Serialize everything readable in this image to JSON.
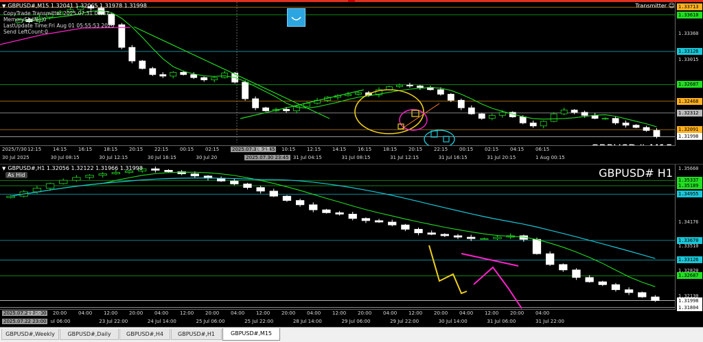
{
  "m15": {
    "symbol_line": "GBPUSD#,M15  1.32041 1.32065 1.31978 1.31998",
    "info_lines": [
      "CopyTrade Transmitter 2025.07.31 09:37",
      "MemorySlotNo:0",
      "LastUpdate Time:Fri Aug 01 05:55:53 2025",
      "Send LeftCount:0"
    ],
    "watermark": "GBPUSD# M15",
    "transmitter_label": "Transmitter",
    "smiley": "☺",
    "price_labels": [
      {
        "text": "1.33713",
        "bg": "#ffb020",
        "y": 1.33713
      },
      {
        "text": "1.33610",
        "bg": "#22dd22",
        "y": 1.3361
      },
      {
        "text": "1.33126",
        "bg": "#19c7d8",
        "y": 1.33126
      },
      {
        "text": "1.32687",
        "bg": "#22dd22",
        "y": 1.32687
      },
      {
        "text": "1.32468",
        "bg": "#ffb020",
        "y": 1.32468
      },
      {
        "text": "1.32312",
        "bg": "#bbbbbb",
        "y": 1.32312
      },
      {
        "text": "1.32091",
        "bg": "#ffb020",
        "y": 1.32091
      },
      {
        "text": "1.31998",
        "bg": "#ffffff",
        "y": 1.31998
      }
    ],
    "price_plain": [
      {
        "text": "1.33360",
        "y": 1.3336
      },
      {
        "text": "1.33015",
        "y": 1.33015
      }
    ],
    "time_labels": [
      {
        "text": "2025/7/30",
        "hl": false
      },
      {
        "text": "12:15",
        "hl": false
      },
      {
        "text": "14:15",
        "hl": false
      },
      {
        "text": "16:15",
        "hl": false
      },
      {
        "text": "18:15",
        "hl": false
      },
      {
        "text": "20:15",
        "hl": false
      },
      {
        "text": "22:15",
        "hl": false
      },
      {
        "text": "00:15",
        "hl": false
      },
      {
        "text": "02:15",
        "hl": false
      },
      {
        "text": "2025.07.31 05:45",
        "hl": true
      },
      {
        "text": "08:15",
        "hl": false
      },
      {
        "text": "10:15",
        "hl": false
      },
      {
        "text": "12:15",
        "hl": false
      },
      {
        "text": "14:15",
        "hl": false
      },
      {
        "text": "16:15",
        "hl": false
      },
      {
        "text": "18:15",
        "hl": false
      },
      {
        "text": "20:15",
        "hl": false
      },
      {
        "text": "22:15",
        "hl": false
      },
      {
        "text": "00:15",
        "hl": false
      },
      {
        "text": "02:15",
        "hl": false
      },
      {
        "text": "04:15",
        "hl": false
      },
      {
        "text": "06:15",
        "hl": false
      }
    ],
    "date_labels": [
      {
        "text": "30 Jul 2025",
        "hl": false
      },
      {
        "text": "30 Jul 08:15",
        "hl": false
      },
      {
        "text": "30 Jul 12:15",
        "hl": false
      },
      {
        "text": "30 Jul 16:15",
        "hl": false
      },
      {
        "text": "30 Jul 20",
        "hl": false
      },
      {
        "text": "2025.07.30 23:45",
        "hl": true
      },
      {
        "text": "31 Jul 04:15",
        "hl": false
      },
      {
        "text": "31 Jul 08:15",
        "hl": false
      },
      {
        "text": "31 Jul 12:15",
        "hl": false
      },
      {
        "text": "31 Jul 16:15",
        "hl": false
      },
      {
        "text": "31 Jul 20:15",
        "hl": false
      },
      {
        "text": "1 Aug 00:15",
        "hl": false
      }
    ]
  },
  "h1": {
    "symbol_line": "GBPUSD#,H1  1.32056 1.32122 1.31966 1.31998",
    "as_hide_label": "As Hid",
    "watermark": "GBPUSD# H1",
    "price_labels": [
      {
        "text": "1.35337",
        "bg": "#22dd22",
        "y": 1.35337
      },
      {
        "text": "1.35189",
        "bg": "#22dd22",
        "y": 1.35189
      },
      {
        "text": "1.34955",
        "bg": "#19c7d8",
        "y": 1.34955
      },
      {
        "text": "1.33670",
        "bg": "#19c7d8",
        "y": 1.3367
      },
      {
        "text": "1.33126",
        "bg": "#19c7d8",
        "y": 1.33126
      },
      {
        "text": "1.32687",
        "bg": "#22dd22",
        "y": 1.32687
      },
      {
        "text": "1.31998",
        "bg": "#ffffff",
        "y": 1.31998
      },
      {
        "text": "1.31804",
        "bg": "#ffffff",
        "y": 1.31804
      }
    ],
    "price_plain": [
      {
        "text": "1.35660",
        "y": 1.3566
      },
      {
        "text": "1.34176",
        "y": 1.34176
      },
      {
        "text": "1.33510",
        "y": 1.3351
      },
      {
        "text": "1.32820",
        "y": 1.3282
      },
      {
        "text": "1.32130",
        "y": 1.3213
      }
    ],
    "time_labels": [
      {
        "text": "2025.07.23 05:00",
        "hl": true
      },
      {
        "text": "22:00",
        "hl": false
      },
      {
        "text": "20:00",
        "hl": false
      },
      {
        "text": "04:00",
        "hl": false
      },
      {
        "text": "12:00",
        "hl": false
      },
      {
        "text": "20:00",
        "hl": false
      },
      {
        "text": "04:00",
        "hl": false
      },
      {
        "text": "12:00",
        "hl": false
      },
      {
        "text": "20:00",
        "hl": false
      },
      {
        "text": "04:00",
        "hl": false
      },
      {
        "text": "12:00",
        "hl": false
      },
      {
        "text": "20:00",
        "hl": false
      },
      {
        "text": "04:00",
        "hl": false
      },
      {
        "text": "12:00",
        "hl": false
      },
      {
        "text": "20:00",
        "hl": false
      },
      {
        "text": "04:00",
        "hl": false
      },
      {
        "text": "12:00",
        "hl": false
      },
      {
        "text": "20:00",
        "hl": false
      },
      {
        "text": "04:00",
        "hl": false
      },
      {
        "text": "12:00",
        "hl": false
      },
      {
        "text": "20:00",
        "hl": false
      },
      {
        "text": "04:00",
        "hl": false
      }
    ],
    "date_labels": [
      {
        "text": "2025.07.22 23:00",
        "hl": true
      },
      {
        "text": "ul 06:00",
        "hl": false
      },
      {
        "text": "23 Jul 22:00",
        "hl": false
      },
      {
        "text": "24 Jul 14:00",
        "hl": false
      },
      {
        "text": "25 Jul 06:00",
        "hl": false
      },
      {
        "text": "25 Jul 22:00",
        "hl": false
      },
      {
        "text": "28 Jul 14:00",
        "hl": false
      },
      {
        "text": "29 Jul 06:00",
        "hl": false
      },
      {
        "text": "29 Jul 22:00",
        "hl": false
      },
      {
        "text": "30 Jul 14:00",
        "hl": false
      },
      {
        "text": "31 Jul 06:00",
        "hl": false
      },
      {
        "text": "31 Jul 22:00",
        "hl": false
      }
    ]
  },
  "tabs": [
    {
      "label": "GBPUSD#,Weekly",
      "active": false
    },
    {
      "label": "GBPUSD#,Daily",
      "active": false
    },
    {
      "label": "GBPUSD#,H4",
      "active": false
    },
    {
      "label": "GBPUSD#,H1",
      "active": false
    },
    {
      "label": "GBPUSD#,M15",
      "active": true
    }
  ],
  "colors": {
    "bull_candle": "#22dd22",
    "bear_candle": "#ffffff",
    "ma_green": "#22dd22",
    "ma_cyan": "#19c7d8",
    "trendline": "#22dd22",
    "magenta": "#ff22cc",
    "annot_yellow": "#f0d020",
    "annot_cyan": "#19c7d8",
    "h_orange": "#ffb020"
  },
  "chart_data": [
    {
      "type": "candlestick",
      "symbol": "GBPUSD#",
      "timeframe": "M15",
      "ylim": [
        1.3192,
        1.3378
      ],
      "ohlc_close": [
        1.3355,
        1.3352,
        1.3358,
        1.3362,
        1.3365,
        1.3368,
        1.3372,
        1.337,
        1.3362,
        1.3348,
        1.3318,
        1.33,
        1.329,
        1.3282,
        1.328,
        1.3285,
        1.3282,
        1.3278,
        1.3275,
        1.3278,
        1.3284,
        1.3272,
        1.325,
        1.3238,
        1.3234,
        1.3236,
        1.3234,
        1.324,
        1.3244,
        1.3248,
        1.3252,
        1.3254,
        1.3256,
        1.3258,
        1.3255,
        1.3262,
        1.3266,
        1.3268,
        1.3267,
        1.3265,
        1.3262,
        1.3256,
        1.3248,
        1.3238,
        1.323,
        1.3224,
        1.3228,
        1.3232,
        1.3226,
        1.3218,
        1.3214,
        1.322,
        1.323,
        1.3235,
        1.3232,
        1.3228,
        1.3224,
        1.3224,
        1.3218,
        1.3215,
        1.3212,
        1.3208,
        1.32
      ],
      "last": 1.31998
    },
    {
      "type": "candlestick",
      "symbol": "GBPUSD#",
      "timeframe": "H1",
      "ylim": [
        1.3178,
        1.3578
      ],
      "ohlc_close": [
        1.349,
        1.3502,
        1.3512,
        1.3525,
        1.3534,
        1.3542,
        1.3548,
        1.3552,
        1.3556,
        1.356,
        1.3566,
        1.3562,
        1.3558,
        1.3552,
        1.3546,
        1.354,
        1.3532,
        1.3524,
        1.3514,
        1.3504,
        1.349,
        1.3478,
        1.3466,
        1.3452,
        1.3444,
        1.344,
        1.3428,
        1.3422,
        1.3418,
        1.341,
        1.3398,
        1.3388,
        1.3384,
        1.338,
        1.3376,
        1.3372,
        1.3372,
        1.3376,
        1.338,
        1.337,
        1.333,
        1.33,
        1.3285,
        1.3264,
        1.3252,
        1.3244,
        1.323,
        1.3222,
        1.321,
        1.32
      ],
      "last": 1.31998
    }
  ]
}
